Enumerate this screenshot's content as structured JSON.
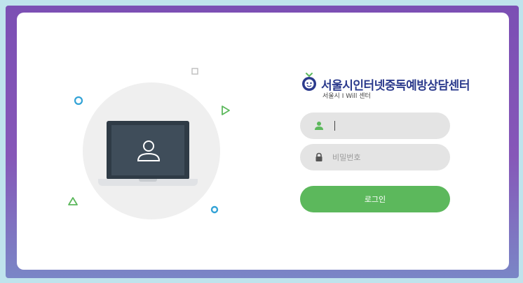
{
  "brand": {
    "title": "서울시인터넷중독예방상담센터",
    "subtitle": "서울시 I Will 센터"
  },
  "login_form": {
    "username_placeholder": "",
    "password_placeholder": "비밀번호",
    "login_label": "로그인"
  },
  "icons": {
    "user_field": "user-icon",
    "password_field": "lock-icon",
    "illustration": "laptop-icon"
  },
  "colors": {
    "accent_green": "#5cb85c",
    "brand_blue": "#2b3a8c",
    "deco_blue": "#33a3d6",
    "frame_purple": "#7b4fb4"
  }
}
